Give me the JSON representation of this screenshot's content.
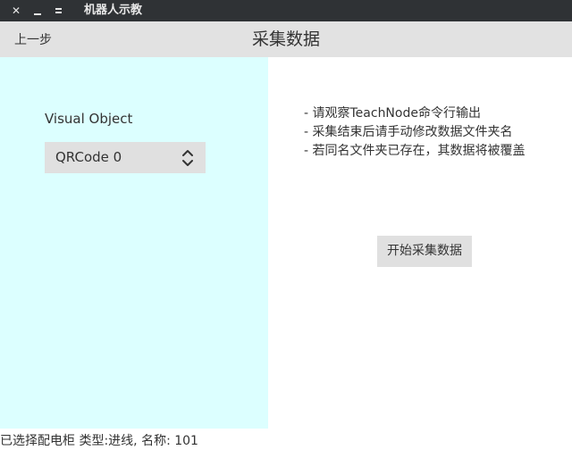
{
  "window": {
    "title": "机器人示教",
    "controls": {
      "close_icon": "close-icon",
      "minimize_icon": "minimize-icon",
      "maximize_icon": "maximize-icon"
    }
  },
  "header": {
    "back_label": "上一步",
    "title": "采集数据"
  },
  "left_panel": {
    "background": "#dcffff",
    "visual_object_label": "Visual Object",
    "visual_object_select": {
      "value": "QRCode 0",
      "icon": "up-down-chevron-icon"
    }
  },
  "right_panel": {
    "notes": [
      "- 请观察TeachNode命令行输出",
      "- 采集结束后请手动修改数据文件夹名",
      "- 若同名文件夹已存在，其数据将被覆盖"
    ],
    "start_button_label": "开始采集数据"
  },
  "status_bar": {
    "text": "已选择配电柜 类型:进线, 名称: 101"
  }
}
